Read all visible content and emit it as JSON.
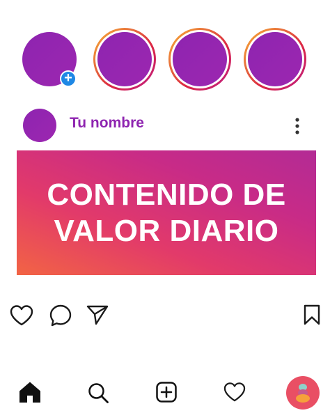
{
  "stories": {
    "add_symbol": "+",
    "items": [
      "story-1",
      "story-2",
      "story-3"
    ]
  },
  "post": {
    "username": "Tu nombre",
    "banner_line_1": "CONTENIDO DE",
    "banner_line_2": "VALOR DIARIO"
  },
  "colors": {
    "purple": "#8e24b0",
    "badge_blue": "#1e88e5",
    "banner_start": "#f26444",
    "banner_end": "#b32b95",
    "profile_button": "#e94f64"
  },
  "icons": {
    "post_actions": [
      "heart-icon",
      "comment-icon",
      "share-icon",
      "bookmark-icon"
    ],
    "bottom_nav": [
      "home-icon",
      "search-icon",
      "add-post-icon",
      "activity-icon",
      "profile-icon"
    ]
  }
}
